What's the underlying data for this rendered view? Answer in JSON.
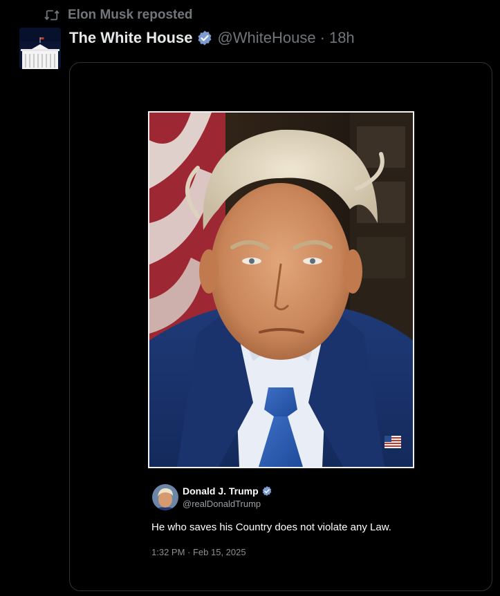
{
  "repost": {
    "label": "Elon Musk reposted",
    "icon": "repost-icon"
  },
  "post": {
    "author_name": "The White House",
    "handle": "@WhiteHouse",
    "separator": "·",
    "time": "18h",
    "verified_icon": "verified-badge-icon",
    "verified_color": "#7d9ccf"
  },
  "quoted": {
    "name": "Donald J. Trump",
    "handle": "@realDonaldTrump",
    "text": "He who saves his Country does not violate any Law.",
    "timestamp": "1:32 PM · Feb 15, 2025",
    "verified_icon": "verified-badge-icon"
  },
  "colors": {
    "background": "#000000",
    "muted_text": "#71767b",
    "card_border": "#2f3336"
  }
}
